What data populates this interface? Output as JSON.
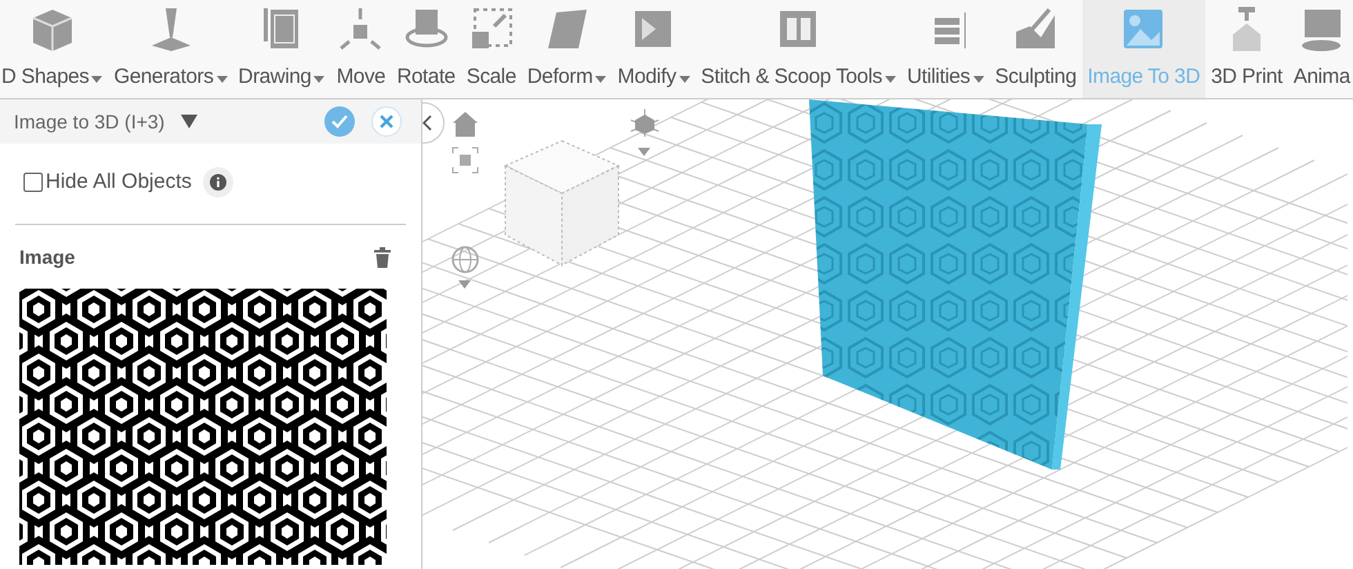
{
  "toolbar": [
    {
      "label": "D Shapes",
      "dropdown": true,
      "selected": false
    },
    {
      "label": "Generators",
      "dropdown": true,
      "selected": false
    },
    {
      "label": "Drawing",
      "dropdown": true,
      "selected": false
    },
    {
      "label": "Move",
      "dropdown": false,
      "selected": false
    },
    {
      "label": "Rotate",
      "dropdown": false,
      "selected": false
    },
    {
      "label": "Scale",
      "dropdown": false,
      "selected": false
    },
    {
      "label": "Deform",
      "dropdown": true,
      "selected": false
    },
    {
      "label": "Modify",
      "dropdown": true,
      "selected": false
    },
    {
      "label": "Stitch & Scoop Tools",
      "dropdown": true,
      "selected": false
    },
    {
      "label": "Utilities",
      "dropdown": true,
      "selected": false
    },
    {
      "label": "Sculpting",
      "dropdown": false,
      "selected": false
    },
    {
      "label": "Image To 3D",
      "dropdown": false,
      "selected": true
    },
    {
      "label": "3D Print",
      "dropdown": false,
      "selected": false
    },
    {
      "label": "Anima",
      "dropdown": false,
      "selected": false
    }
  ],
  "panel": {
    "title": "Image to 3D (I+3)",
    "hide_all_objects": {
      "label": "Hide All Objects",
      "checked": false
    },
    "image_section": {
      "label": "Image"
    }
  }
}
